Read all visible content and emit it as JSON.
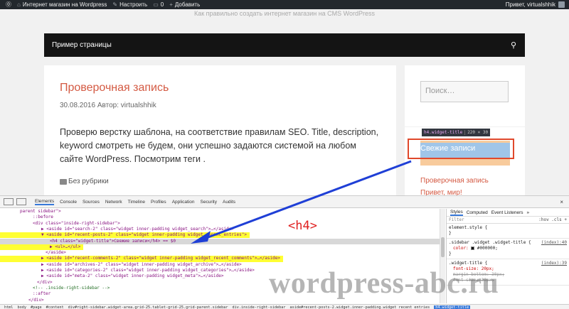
{
  "adminbar": {
    "site_name": "Интернет магазин на Wordpress",
    "customize": "Настроить",
    "comments": "0",
    "add_new": "Добавить",
    "greeting": "Привет, virtualshhik"
  },
  "site": {
    "tagline": "Как правильно создать интернет магазин на CMS WordPress",
    "nav_item": "Пример страницы"
  },
  "post": {
    "title": "Проверочная запись",
    "date": "30.08.2016",
    "author_label": "Автор:",
    "author": "virtualshhik",
    "text": "Проверю верстку шаблона, на соответствие правилам SEO. Title, description, keyword смотреть не будем, они успешно задаются системой на любом сайте WordPress. Посмотрим теги .",
    "category": "Без рубрики"
  },
  "sidebar": {
    "search_placeholder": "Поиск…",
    "tooltip_tag": "h4.widget-title",
    "tooltip_size": "220 × 30",
    "widget_title": "Свежие записи",
    "recent_posts": [
      "Проверочная запись",
      "Привет, мир!"
    ]
  },
  "devtools": {
    "tabs": [
      "Elements",
      "Console",
      "Sources",
      "Network",
      "Timeline",
      "Profiles",
      "Application",
      "Security",
      "Audits"
    ],
    "close": "×",
    "lines": [
      {
        "indent": 0,
        "text": "parent sidebar\">",
        "kind": "attr"
      },
      {
        "indent": 3,
        "text": "::before",
        "kind": "pseudo"
      },
      {
        "indent": 3,
        "text": "<div class=\"inside-right-sidebar\">",
        "kind": "tag"
      },
      {
        "indent": 5,
        "text": "▶ <aside id=\"search-2\" class=\"widget inner-padding widget_search\">…</aside>",
        "kind": "tag"
      },
      {
        "indent": 5,
        "text": "▼ <aside id=\"recent-posts-2\" class=\"widget inner-padding widget_recent_entries\">",
        "kind": "tag",
        "hl": "yellow"
      },
      {
        "indent": 7,
        "text": "<h4 class=\"widget-title\">Свежие записи</h4> == $0",
        "kind": "tag",
        "hl": "grey"
      },
      {
        "indent": 7,
        "text": "▶ <ul>…</ul>",
        "kind": "tag",
        "hl": "yellow"
      },
      {
        "indent": 6,
        "text": "</aside>",
        "kind": "tag"
      },
      {
        "indent": 5,
        "text": "▶ <aside id=\"recent-comments-2\" class=\"widget inner-padding widget_recent_comments\">…</aside>",
        "kind": "tag",
        "hl": "yellow"
      },
      {
        "indent": 5,
        "text": "▶ <aside id=\"archives-2\" class=\"widget inner-padding widget_archive\">…</aside>",
        "kind": "tag"
      },
      {
        "indent": 5,
        "text": "▶ <aside id=\"categories-2\" class=\"widget inner-padding widget_categories\">…</aside>",
        "kind": "tag"
      },
      {
        "indent": 5,
        "text": "▶ <aside id=\"meta-2\" class=\"widget inner-padding widget_meta\">…</aside>",
        "kind": "tag"
      },
      {
        "indent": 4,
        "text": "</div>",
        "kind": "tag"
      },
      {
        "indent": 3,
        "text": "<!-- .inside-right-sidebar -->",
        "kind": "comment"
      },
      {
        "indent": 3,
        "text": "::after",
        "kind": "pseudo"
      },
      {
        "indent": 2,
        "text": "</div>",
        "kind": "tag"
      }
    ],
    "styles": {
      "tabs": [
        "Styles",
        "Computed",
        "Event Listeners",
        "»"
      ],
      "filter": "Filter",
      "filter_right": ":hov  .cls  +",
      "element_style": "element.style {",
      "close_brace": "}",
      "rule1_selector": ".sidebar .widget .widget-title {",
      "rule1_source": "(index):40",
      "rule1_prop": "color: ",
      "rule1_value": "#000000;",
      "rule2_selector": ".widget-title {",
      "rule2_source": "(index):39",
      "rule2_prop1": "font-size: 20px;",
      "rule2_prop2": "margin-bottom: 30px;",
      "rule2_prop3": "font-size: 20px;"
    },
    "breadcrumbs": [
      "html",
      "body",
      "#page",
      "#content",
      "div#right-sidebar.widget-area.grid-25.tablet-grid-25.grid-parent.sidebar",
      "div.inside-right-sidebar",
      "aside#recent-posts-2.widget.inner-padding.widget_recent_entries",
      "h4.widget-title"
    ]
  },
  "annotation": {
    "label": "<h4>",
    "watermark": "wordpress-abc.ru",
    "arrow_color": "#1f3fd6",
    "box_color": "#e0482b"
  }
}
